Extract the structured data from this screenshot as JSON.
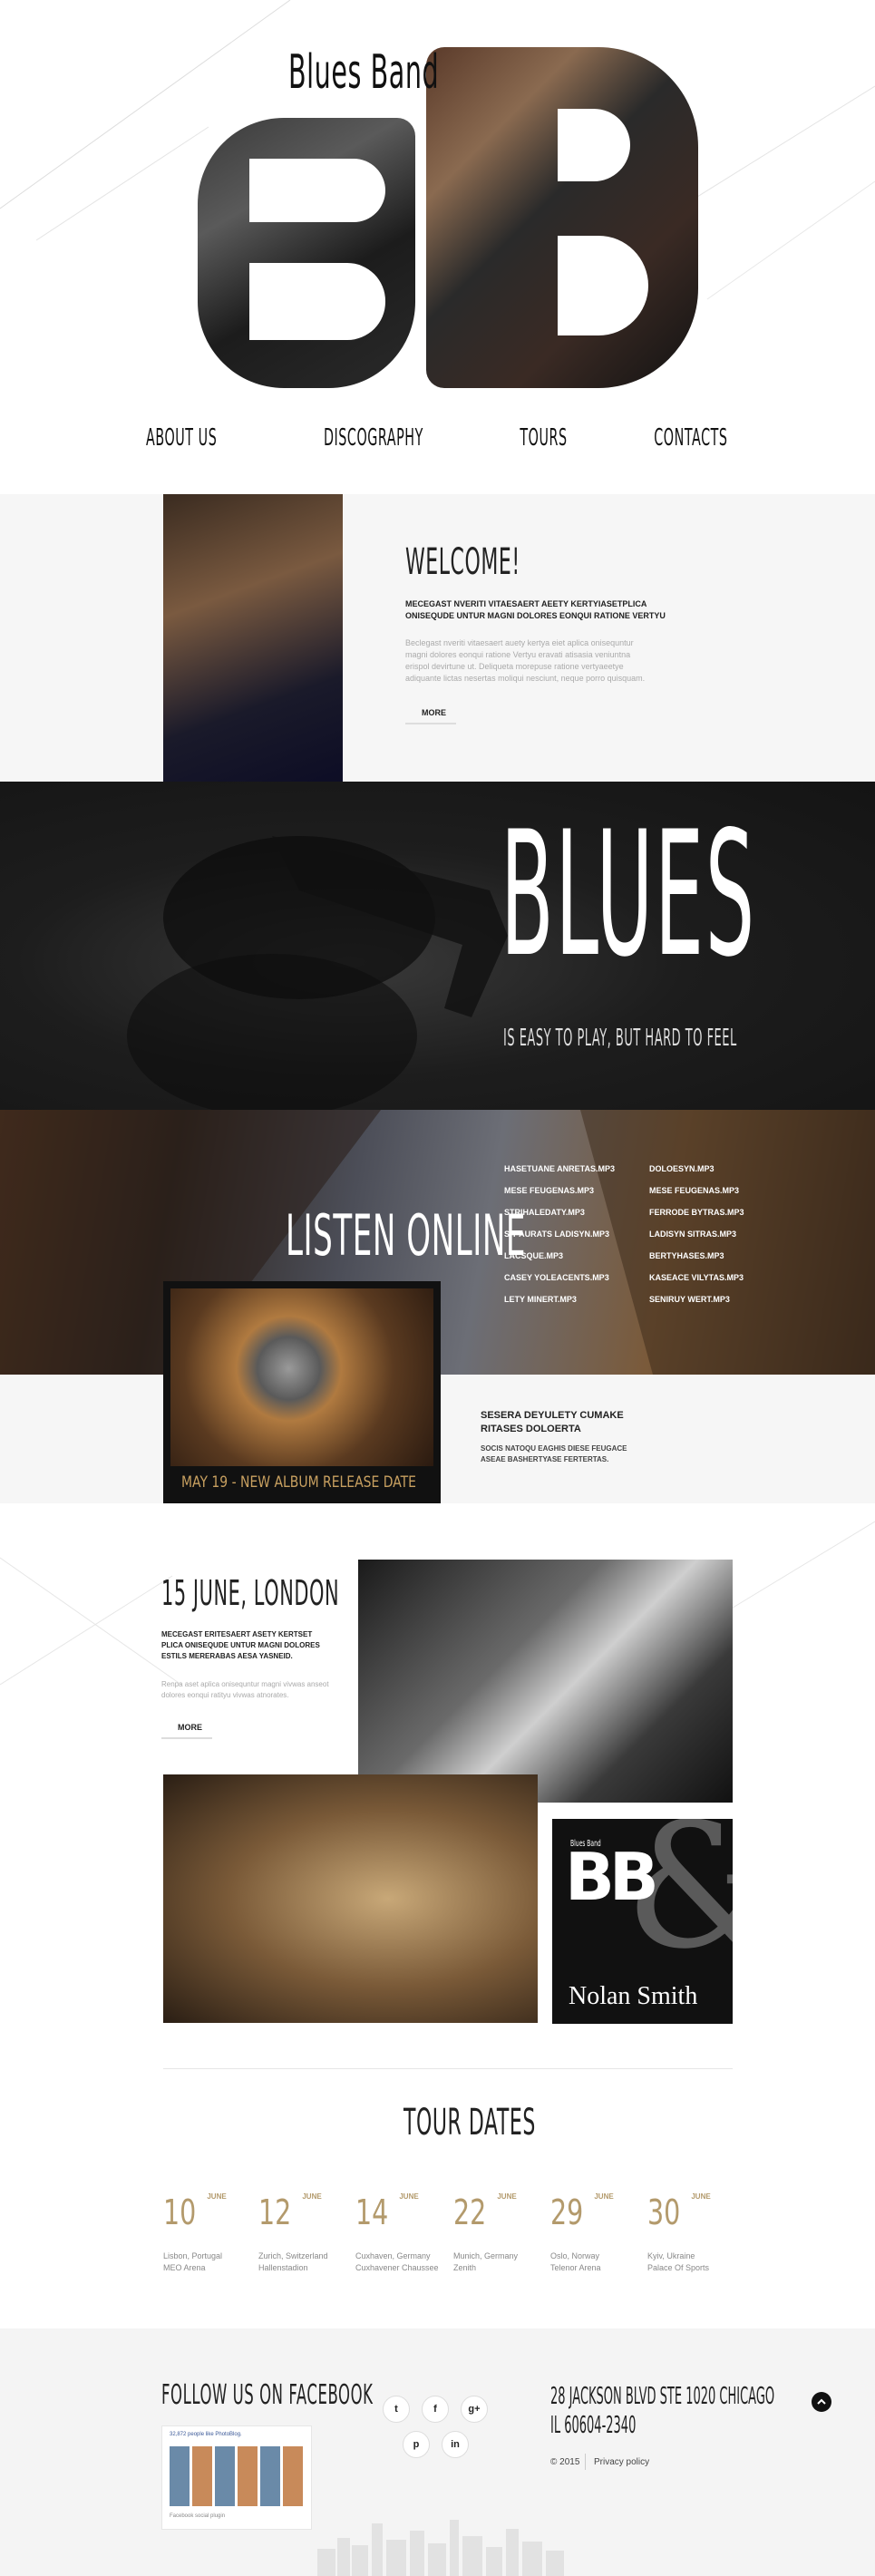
{
  "header": {
    "brand": "Blues Band",
    "logo_letters": "BB",
    "nav": [
      "ABOUT US",
      "DISCOGRAPHY",
      "TOURS",
      "CONTACTS"
    ]
  },
  "welcome": {
    "title": "WELCOME!",
    "lead": "MECEGAST NVERITI VITAESAERT AEETY KERTYIASETPLICA ONISEQUDE UNTUR MAGNI DOLORES EONQUI RATIONE VERTYU",
    "body": "Beclegast nveriti vitaesaert auety kertya eiet aplica onisequntur magni dolores eonqui ratione Vertyu eravati atisasia veniuntna erispol devirtune ut. Deliqueta morepuse ratione vertyaeetye adiquante lictas nesertas moliqui nesciunt, neque porro quisquam.",
    "more": "MORE"
  },
  "blues_banner": {
    "headline": "BLUES",
    "tagline": "IS EASY TO PLAY, BUT HARD TO FEEL"
  },
  "listen": {
    "title": "LISTEN ONLINE",
    "tracks_left": [
      "HASETUANE ANRETAS.MP3",
      "MESE FEUGENAS.MP3",
      "STRIHALEDATY.MP3",
      "SIT AURATS LADISYN.MP3",
      "LACSQUE.MP3",
      "CASEY YOLEACENTS.MP3",
      "LETY MINERT.MP3"
    ],
    "tracks_right": [
      "DOLOESYN.MP3",
      "MESE FEUGENAS.MP3",
      "FERRODE BYTRAS.MP3",
      "LADISYN SITRAS.MP3",
      "BERTYHASES.MP3",
      "KASEACE VILYTAS.MP3",
      "SENIRUY WERT.MP3"
    ]
  },
  "album": {
    "release": "MAY 19 - NEW ALBUM RELEASE DATE",
    "title": "SESERA DEYULETY CUMAKE RITASES DOLOERTA",
    "desc": "SOCIS NATOQU EAGHIS DIESE FEUGACE ASEAE BASHERTYASE FERTERTAS."
  },
  "event": {
    "title": "15 JUNE, LONDON",
    "lead": "MECEGAST ERITESAERT ASETY KERTSET PLICA ONISEQUDE UNTUR MAGNI DOLORES ESTILS MERERABAS AESA YASNEID.",
    "body": "Renpa aset aplica onisequntur magni vivwas anseot dolores eonqui ratityu vivwas atnorates.",
    "more": "MORE",
    "card_brand": "Blues Band",
    "card_letters": "BB",
    "card_amp": "&",
    "card_name": "Nolan Smith"
  },
  "tours": {
    "title": "TOUR DATES",
    "dates": [
      {
        "day": "10",
        "month": "JUNE",
        "city": "Lisbon, Portugal",
        "venue": "MEO Arena"
      },
      {
        "day": "12",
        "month": "JUNE",
        "city": "Zurich, Switzerland",
        "venue": "Hallenstadion"
      },
      {
        "day": "14",
        "month": "JUNE",
        "city": "Cuxhaven, Germany",
        "venue": "Cuxhavener Chaussee"
      },
      {
        "day": "22",
        "month": "JUNE",
        "city": "Munich, Germany",
        "venue": "Zenith"
      },
      {
        "day": "29",
        "month": "JUNE",
        "city": "Oslo, Norway",
        "venue": "Telenor Arena"
      },
      {
        "day": "30",
        "month": "JUNE",
        "city": "Kyiv, Ukraine",
        "venue": "Palace Of Sports"
      }
    ]
  },
  "footer": {
    "follow_title": "FOLLOW US ON FACEBOOK",
    "fb_text": "32,872 people like PhotoBlog.",
    "fb_plugin": "Facebook social plugin",
    "social": [
      "t",
      "f",
      "g+",
      "p",
      "in"
    ],
    "address": "28 JACKSON BLVD STE 1020 CHICAGO",
    "phone": "IL 60604-2340",
    "copyright": "© 2015",
    "privacy": "Privacy policy",
    "to_top_icon": "chevron-up-icon"
  },
  "colors": {
    "accent": "#b39a6c",
    "dark": "#141414",
    "light_bg": "#f6f6f6"
  }
}
